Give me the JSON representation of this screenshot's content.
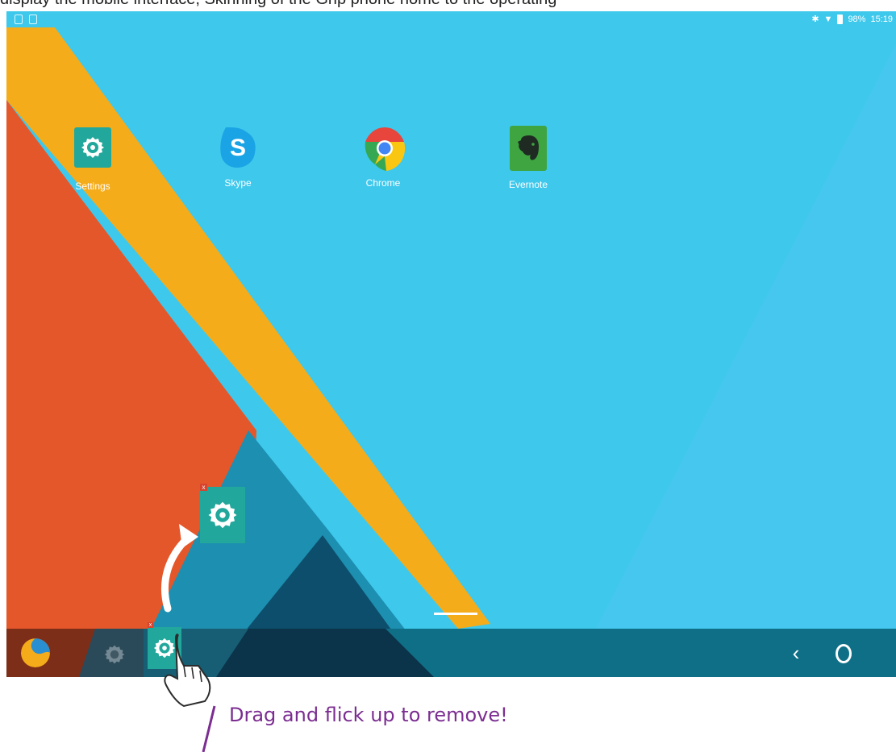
{
  "top_text": "display the mobile interface, Skinning of the Grip phone home to the operating",
  "status_bar": {
    "battery_text": "98%",
    "time": "15:19",
    "icons": [
      "screenshot-icon",
      "lock-icon",
      "bluetooth-icon",
      "wifi-icon",
      "battery-icon"
    ]
  },
  "apps": [
    {
      "label": "Settings",
      "icon": "settings-gear-icon"
    },
    {
      "label": "Skype",
      "icon": "skype-icon"
    },
    {
      "label": "Chrome",
      "icon": "chrome-icon"
    },
    {
      "label": "Evernote",
      "icon": "evernote-elephant-icon"
    }
  ],
  "taskbar": {
    "nav_back": "‹",
    "icons": [
      "start-menu-icon",
      "pinned-settings-icon",
      "dragged-settings-icon",
      "back-icon",
      "home-icon"
    ]
  },
  "drag_badge": "x",
  "caption": "Drag and flick up to remove!",
  "colors": {
    "sky": "#3ec8ec",
    "orange": "#e4572a",
    "yellow": "#f5ac1a",
    "teal": "#21a79b",
    "taskbar": "#0f6f87",
    "caption": "#7b2d91"
  }
}
